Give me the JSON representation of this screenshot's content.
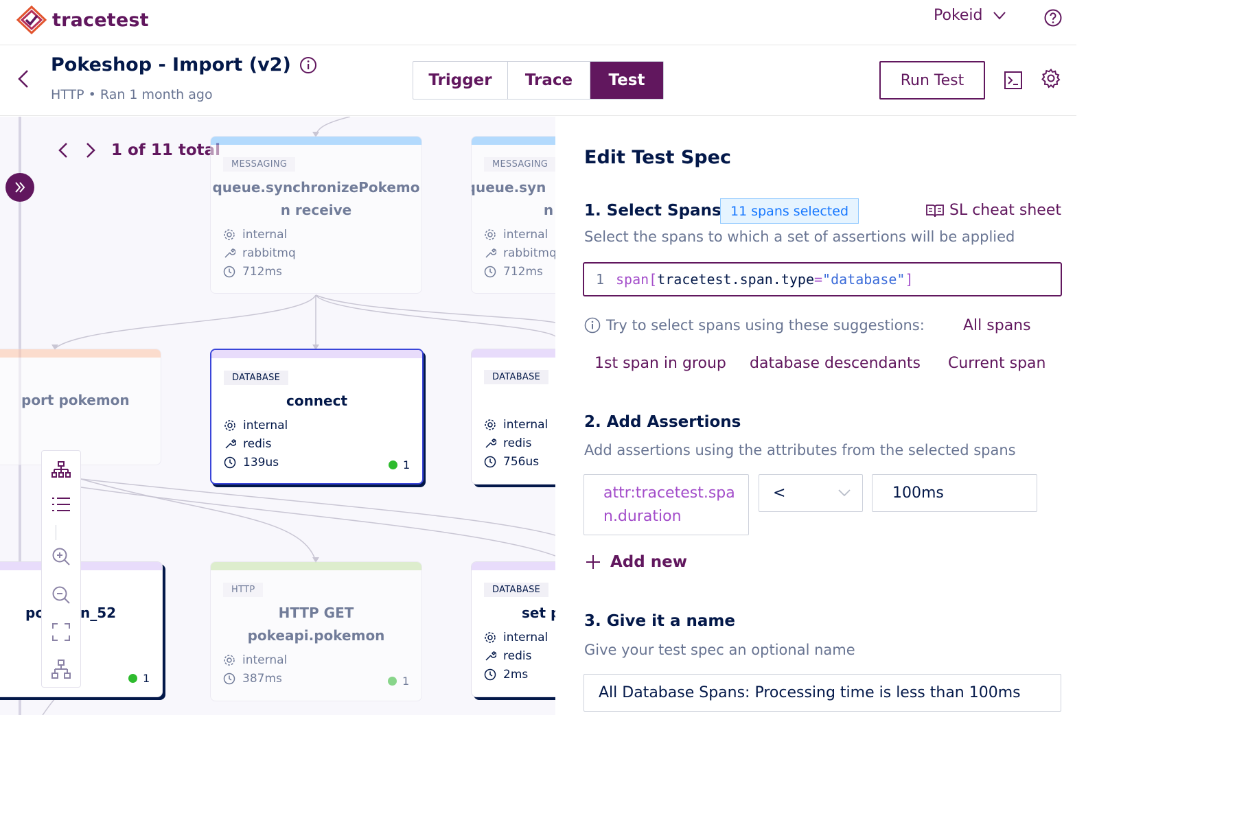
{
  "app": {
    "name": "tracetest",
    "environment": "Pokeid"
  },
  "header": {
    "title": "Pokeshop - Import (v2)",
    "subtitle": "HTTP • Ran 1 month ago",
    "tabs": [
      {
        "label": "Trigger"
      },
      {
        "label": "Trace"
      },
      {
        "label": "Test",
        "active": true
      }
    ],
    "run_label": "Run Test"
  },
  "diagram": {
    "nav_label": "1 of 11 total",
    "nodes": [
      {
        "type": "MESSAGING",
        "title_l1": "queue.synchronizePokemo",
        "title_l2": "n receive",
        "attrs": [
          "internal",
          "rabbitmq",
          "712ms"
        ],
        "accent": "#cce9ff"
      },
      {
        "type": "MESSAGING",
        "title_l1": "queue.syn",
        "title_l2": "n",
        "attrs": [
          "internal",
          "rabbitmq",
          "712ms"
        ],
        "accent": "#cce9ff"
      },
      {
        "type": "",
        "title_l1": "port pokemon",
        "accent": "#ffe0cc"
      },
      {
        "type": "DATABASE",
        "title_l1": "connect",
        "attrs": [
          "internal",
          "redis",
          "139us"
        ],
        "count": "1",
        "accent": "#e8dcfb"
      },
      {
        "type": "DATABASE",
        "attrs": [
          "internal",
          "redis",
          "756us"
        ],
        "accent": "#e8dcfb"
      },
      {
        "type": "",
        "title_l1": "pc",
        "title_l2": "n_52",
        "count": "1",
        "accent": "#e8dcfb"
      },
      {
        "type": "HTTP",
        "title_l1": "HTTP GET",
        "title_l2": "pokeapi.pokemon",
        "attrs": [
          "internal",
          "387ms"
        ],
        "count": "1",
        "accent": "#dff0d0"
      },
      {
        "type": "DATABASE",
        "title_l1": "set p",
        "attrs": [
          "internal",
          "redis",
          "2ms"
        ],
        "accent": "#e8dcfb"
      }
    ]
  },
  "panel": {
    "title": "Edit Test Spec",
    "step1": {
      "heading": "1. Select Spans",
      "chip": "11 spans selected",
      "cheat_sheet": "SL cheat sheet",
      "description": "Select the spans to which a set of assertions will be applied",
      "editor_line": "1",
      "code_kw": "span[",
      "code_prop": "tracetest.span.type",
      "code_eq": "=",
      "code_str": "\"database\"",
      "code_end": "]",
      "suggest_prefix": "Try to select spans using these suggestions:",
      "suggestions": [
        "All spans",
        "1st span in group",
        "database descendants",
        "Current span"
      ]
    },
    "step2": {
      "heading": "2. Add Assertions",
      "description": "Add assertions using the attributes from the selected spans",
      "attr_l1": "attr:tracetest.spa",
      "attr_l2": "n.duration",
      "operator": "<",
      "value": "100ms",
      "add_new": "Add new"
    },
    "step3": {
      "heading": "3. Give it a name",
      "description": "Give your test spec an optional name",
      "name_value": "All Database Spans: Processing time is less than 100ms"
    }
  },
  "colors": {
    "brand": "#61175e",
    "text": "#031849",
    "muted": "#687492",
    "link": "#1677ff",
    "success": "#2ebb2e"
  }
}
